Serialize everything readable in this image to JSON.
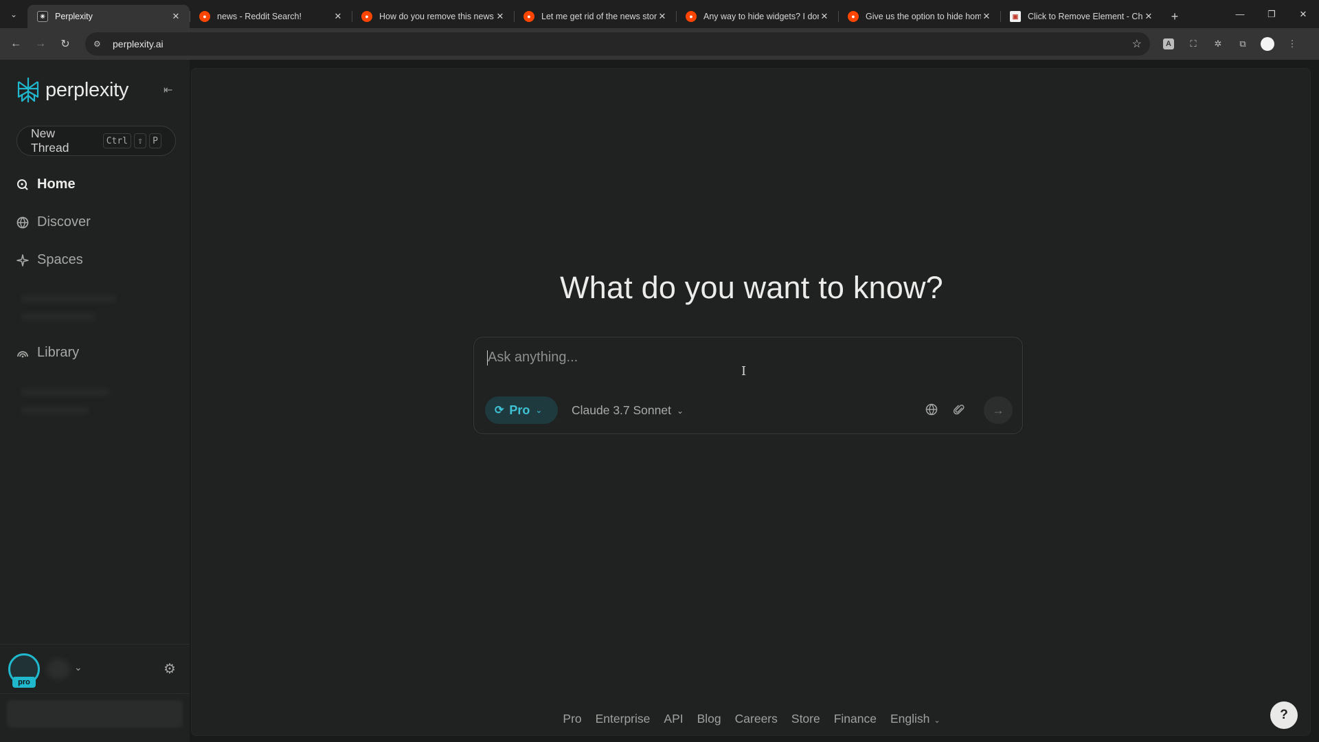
{
  "browser": {
    "tabs": [
      {
        "title": "Perplexity",
        "favicon": "perplexity-favicon",
        "active": true
      },
      {
        "title": "news - Reddit Search!",
        "favicon": "reddit-favicon",
        "active": false
      },
      {
        "title": "How do you remove this news",
        "favicon": "reddit-favicon",
        "active": false
      },
      {
        "title": "Let me get rid of the news story",
        "favicon": "reddit-favicon",
        "active": false
      },
      {
        "title": "Any way to hide widgets? I don",
        "favicon": "reddit-favicon",
        "active": false
      },
      {
        "title": "Give us the option to hide hom",
        "favicon": "reddit-favicon",
        "active": false
      },
      {
        "title": "Click to Remove Element - Chr",
        "favicon": "extension-favicon",
        "active": false
      }
    ],
    "url": "perplexity.ai"
  },
  "sidebar": {
    "logo_text": "perplexity",
    "new_thread": {
      "label": "New Thread",
      "keys": [
        "Ctrl",
        "⇧",
        "P"
      ]
    },
    "nav": [
      {
        "label": "Home",
        "icon": "search-circle-icon",
        "active": true
      },
      {
        "label": "Discover",
        "icon": "globe-icon",
        "active": false
      },
      {
        "label": "Spaces",
        "icon": "sparkle-icon",
        "active": false
      },
      {
        "label": "Library",
        "icon": "library-icon",
        "active": false
      }
    ],
    "user": {
      "badge": "pro"
    }
  },
  "main": {
    "headline": "What do you want to know?",
    "ask": {
      "placeholder": "Ask anything...",
      "mode": "Pro",
      "model": "Claude 3.7 Sonnet"
    },
    "footer": {
      "links": [
        "Pro",
        "Enterprise",
        "API",
        "Blog",
        "Careers",
        "Store",
        "Finance"
      ],
      "language": "English"
    },
    "help_label": "?"
  },
  "colors": {
    "accent": "#1fb8cd",
    "background": "#202222",
    "sidebar": "#202222"
  }
}
